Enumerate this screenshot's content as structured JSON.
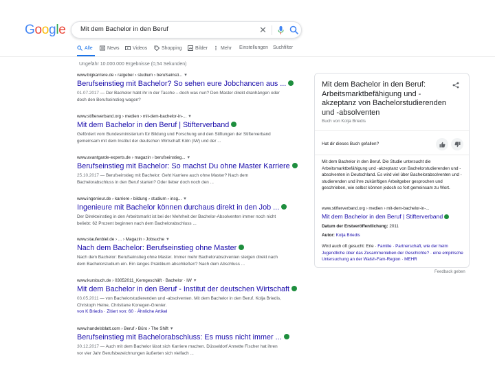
{
  "logo": {
    "letters": [
      "G",
      "o",
      "o",
      "g",
      "l",
      "e"
    ],
    "colors": [
      "#4285f4",
      "#ea4335",
      "#fbbc05",
      "#4285f4",
      "#34a853",
      "#ea4335"
    ]
  },
  "search": {
    "value": "Mit dem Bachelor in den Beruf"
  },
  "tabs": [
    {
      "label": "Alle",
      "icon": "search-icon",
      "active": true
    },
    {
      "label": "News",
      "icon": "news-icon",
      "active": false
    },
    {
      "label": "Videos",
      "icon": "video-icon",
      "active": false
    },
    {
      "label": "Shopping",
      "icon": "tag-icon",
      "active": false
    },
    {
      "label": "Bilder",
      "icon": "image-icon",
      "active": false
    },
    {
      "label": "Mehr",
      "icon": "more-icon",
      "active": false
    },
    {
      "label": "Einstellungen",
      "icon": "",
      "active": false
    },
    {
      "label": "Suchfilter",
      "icon": "",
      "active": false
    }
  ],
  "stats": "Ungefähr 10.000.000 Ergebnisse (0,54 Sekunden)",
  "results": [
    {
      "url": "www.bigkarriere.de › ratgeber › studium › berufseinsti...",
      "title": "Berufseinstieg mit Bachelor? So sehen eure Jobchancen aus ...",
      "date": "01.07.2017",
      "snippet": " — Der Bachelor habt ihr in der Tasche – doch was nun? Den Master direkt dranhängen oder doch den Berufseinstieg wagen?"
    },
    {
      "url": "www.stifterverband.org › medien › mit-dem-bachelor-in-...",
      "title": "Mit dem Bachelor in den Beruf | Stifterverband",
      "date": "",
      "snippet": "Gefördert vom Bundesministerium für Bildung und Forschung und den Stiftungen der Stifterverband gemeinsam mit dem Institut der deutschen Wirtschaft Köln (IW) und der ..."
    },
    {
      "url": "www.avantgarde-experts.de › magazin › berufseinstieg...",
      "title": "Berufseinstieg mit Bachelor: So machst Du ohne Master Karriere",
      "date": "25.10.2017",
      "snippet": " — Berufseinstieg mit Bachelor: Geht Karriere auch ohne Master? Nach dem Bachelorabschluss in den Beruf starten? Oder lieber doch noch den ..."
    },
    {
      "url": "www.ingenieur.de › karriere › bildung › studium › insg...",
      "title": "Ingenieure mit Bachelor können durchaus direkt in den Job ...",
      "date": "",
      "snippet": "Der Direkteinstieg in den Arbeitsmarkt ist bei der Mehrheit der Bachelor-Absolventen immer noch nicht beliebt: 62 Prozent beginnen nach dem Bachelorabschluss ..."
    },
    {
      "url": "www.staufenbiel.de › ... › Magazin › Jobsuche",
      "title": "Nach dem Bachelor: Berufseinstieg ohne Master",
      "date": "",
      "snippet": "Nach dem Bachelor: Berufseinstieg ohne Master. Immer mehr Bachelorabsolventen steigen direkt nach dem Bachelorstudium ein. Ein langes Praktikum abschließen? Nach dem Abschluss ..."
    },
    {
      "url": "www.kursbuch.de › 03052011_Kerngeschäft · Bachelor · IW",
      "title": "Mit dem Bachelor in den Beruf - Institut der deutschen Wirtschaft",
      "date": "03.05.2011",
      "snippet": " — von Bachelorstudierenden und -absolventen. Mit dem Bachelor in den Beruf. Kolja Briedis, Christoph Heine, Christiane Konegen-Grenier.",
      "extra": "von K Briedis · Zitiert von: 60 · Ähnliche Artikel"
    },
    {
      "url": "www.handelsblatt.com › Beruf › Büro › The Shift",
      "title": "Berufseinstieg mit Bachelorabschluss: Es muss nicht immer ...",
      "date": "30.12.2017",
      "snippet": " — Auch mit dem Bachelor lässt sich Karriere machen. Düsseldorf Annette Fischer hat ihren vor vier Jahr Berufsbezeichnungen äußerten sich vielfach ..."
    }
  ],
  "knowledge_panel": {
    "title": "Mit dem Bachelor in den Beruf: Arbeitsmarktbefähigung und -akzeptanz von Bachelorstudierenden und -absolventen",
    "author": "Buch von Kolja Briedis",
    "question": "Hat dir dieses Buch gefallen?",
    "description": "Mit dem Bachelor in den Beruf. Die Studie untersucht die Arbeitsmarktbefähigung und -akzeptanz von Bachelorstudierenden und -absolventen in Deutschland. Es wird viel über Bachelorabsolventen und -studierenden und ihre zukünftigen Arbeitgeber gesprochen und geschrieben, wie selbst können jedoch so fort gemeinsam zu Wort.",
    "source_url": "www.stifterverband.org › medien › mit-dem-bachelor-in-...",
    "source_title": "Mit dem Bachelor in den Beruf | Stifterverband",
    "facts": [
      {
        "label": "Datum der Erstveröffentlichung:",
        "value": "2011"
      },
      {
        "label": "Autor:",
        "value": "Kolja Briedis"
      }
    ],
    "quote_text": "Wird auch oft gesucht: Erie · ",
    "quote_links": "Familie · Partnerschaft, wie der heim Jugendliche über das Zusammenleben der Geschichte? · eine empirische Untersuchung an der Walsh-Fam-Region · MEHR"
  },
  "feedback": "Feedback geben"
}
